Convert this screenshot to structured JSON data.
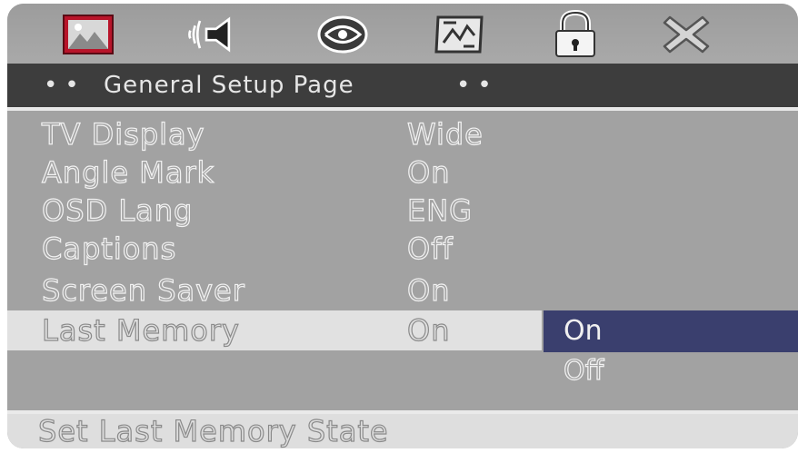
{
  "tabs": [
    {
      "icon": "picture-icon"
    },
    {
      "icon": "audio-speaker-icon"
    },
    {
      "icon": "video-reel-icon"
    },
    {
      "icon": "preferences-icon"
    },
    {
      "icon": "lock-icon"
    },
    {
      "icon": "exit-icon"
    }
  ],
  "title": {
    "dots_left": "••",
    "text": "General Setup Page",
    "dots_right": "••"
  },
  "menu": {
    "rows": [
      {
        "label": "TV Display",
        "value": "Wide"
      },
      {
        "label": "Angle Mark",
        "value": "On"
      },
      {
        "label": "OSD Lang",
        "value": "ENG"
      },
      {
        "label": "Captions",
        "value": "Off"
      },
      {
        "label": "Screen Saver",
        "value": "On"
      },
      {
        "label": "Last Memory",
        "value": "On"
      }
    ],
    "options": [
      "On",
      "Off"
    ],
    "highlighted_option": "On"
  },
  "status": {
    "text": "Set Last Memory State"
  },
  "colors": {
    "background": "#a2a2a2",
    "title_bar": "#3d3d3d",
    "selected_row": "#e1e1e1",
    "highlight": "#3a3f6e"
  }
}
